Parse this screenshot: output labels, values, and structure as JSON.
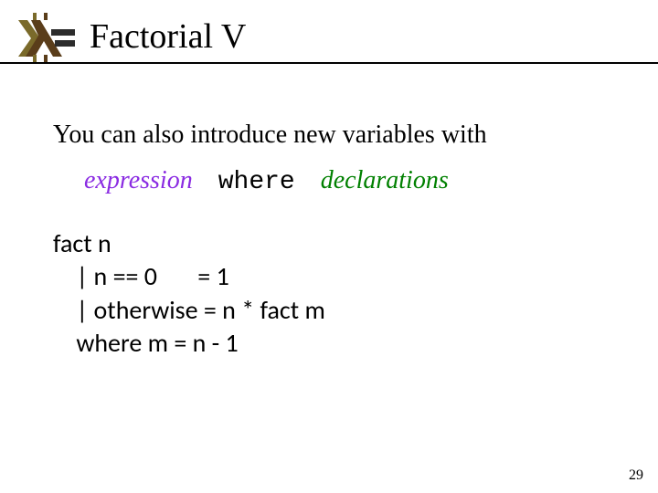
{
  "title": "Factorial V",
  "intro": "You can also introduce new variables with",
  "syntax": {
    "expression": "expression",
    "where": "where",
    "declarations": "declarations"
  },
  "code": {
    "l1": "fact n",
    "l2": "    | n == 0       = 1",
    "l3": "    | otherwise = n * fact m",
    "l4": "    where m = n - 1"
  },
  "page_number": "29",
  "logo": {
    "name": "haskell-logo",
    "colors": {
      "olive": "#7a6a2a",
      "brown": "#5a3d1a",
      "dark": "#2c2c2c"
    }
  }
}
